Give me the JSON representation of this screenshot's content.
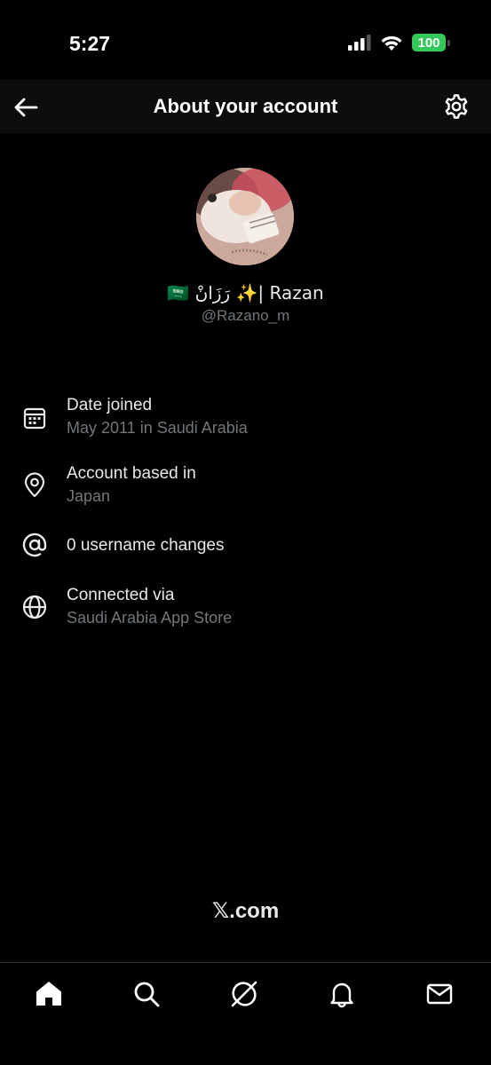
{
  "status_bar": {
    "time": "5:27",
    "battery": "100",
    "icons": [
      "signal-icon",
      "wifi-icon",
      "battery-icon"
    ]
  },
  "header": {
    "title": "About your account",
    "back_icon": "arrow-left-icon",
    "settings_icon": "gear-icon"
  },
  "profile": {
    "display_name": "🇸🇦 رَزَانْ ✨| Razan",
    "handle": "@Razano_m"
  },
  "info": {
    "date_joined": {
      "label": "Date joined",
      "value": "May 2011 in Saudi Arabia",
      "icon": "calendar-icon"
    },
    "account_based": {
      "label": "Account based in",
      "value": "Japan",
      "icon": "location-pin-icon"
    },
    "username_changes": {
      "label": "0 username changes",
      "icon": "at-sign-icon"
    },
    "connected_via": {
      "label": "Connected via",
      "value": "Saudi Arabia App Store",
      "icon": "globe-icon"
    }
  },
  "footer": {
    "brand": "𝕏.com"
  },
  "bottom_nav": {
    "items": [
      "home-icon",
      "search-icon",
      "grok-icon",
      "notifications-icon",
      "messages-icon"
    ]
  },
  "colors": {
    "background": "#000000",
    "text_primary": "#e7e9ea",
    "text_secondary": "#71767b",
    "battery_green": "#34c759"
  }
}
